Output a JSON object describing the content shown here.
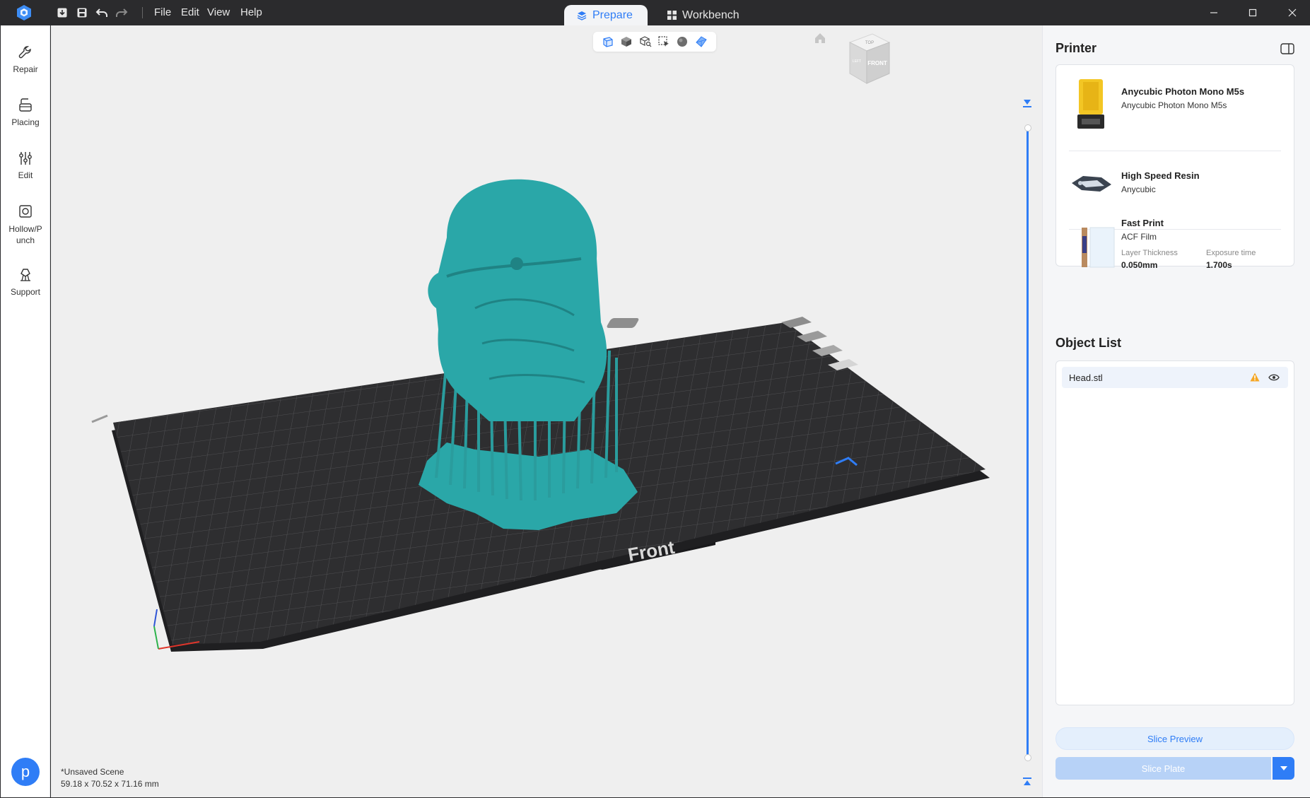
{
  "titlebar": {
    "menu": [
      "File",
      "Edit",
      "View",
      "Help"
    ],
    "tabs": [
      {
        "label": "Prepare",
        "active": true
      },
      {
        "label": "Workbench",
        "active": false
      }
    ]
  },
  "leftbar": {
    "tools": [
      {
        "label": "Repair",
        "icon": "wrench-icon"
      },
      {
        "label": "Placing",
        "icon": "placing-icon"
      },
      {
        "label": "Edit",
        "icon": "sliders-icon"
      },
      {
        "label": "Hollow/Punch",
        "icon": "hollow-icon"
      },
      {
        "label": "Support",
        "icon": "support-icon"
      }
    ],
    "avatar_letter": "p"
  },
  "viewport": {
    "scene_name": "*Unsaved Scene",
    "dimensions": "59.18 x 70.52 x 71.16 mm",
    "plate_label": "Front",
    "cube_labels": {
      "front": "FRONT",
      "top": "TOP",
      "left": "LEFT"
    },
    "model_color": "#2aa7a8"
  },
  "printer": {
    "title": "Printer",
    "machine": {
      "name": "Anycubic Photon Mono M5s",
      "sub": "Anycubic Photon Mono M5s"
    },
    "resin": {
      "name": "High Speed Resin",
      "sub": "Anycubic"
    },
    "profile": {
      "name": "Fast Print",
      "sub": "ACF Film",
      "layer_label": "Layer Thickness",
      "layer_value": "0.050mm",
      "exposure_label": "Exposure time",
      "exposure_value": "1.700s"
    }
  },
  "object_list": {
    "title": "Object List",
    "items": [
      {
        "name": "Head.stl"
      }
    ]
  },
  "actions": {
    "slice_preview": "Slice Preview",
    "slice_plate": "Slice Plate"
  },
  "colors": {
    "accent": "#2f7df6",
    "titlebar": "#2b2b2d",
    "warning": "#f5a623"
  }
}
